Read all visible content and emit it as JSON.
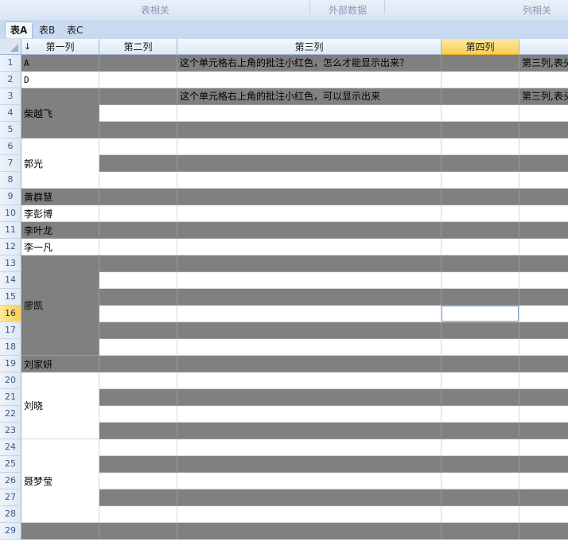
{
  "ribbon": {
    "groups": [
      {
        "label": "表相关"
      },
      {
        "label": "外部数据"
      },
      {
        "label": "列相关"
      }
    ]
  },
  "tabs": [
    {
      "label": "表A",
      "active": true
    },
    {
      "label": "表B",
      "active": false
    },
    {
      "label": "表C",
      "active": false
    }
  ],
  "grid": {
    "sort_indicator": "↓",
    "columns": [
      "第一列",
      "第二列",
      "第三列",
      "第四列",
      ""
    ],
    "selected_column": 3,
    "selected_row": 16,
    "row_numbers": [
      "1",
      "2",
      "3",
      "4",
      "5",
      "6",
      "7",
      "8",
      "9",
      "10",
      "11",
      "12",
      "13",
      "14",
      "15",
      "16",
      "17",
      "18",
      "19",
      "20",
      "21",
      "22",
      "23",
      "24",
      "25",
      "26",
      "27",
      "28",
      "29"
    ],
    "col1_cells": [
      {
        "text": "A"
      },
      {
        "text": "D"
      },
      {
        "text": "柴越飞"
      },
      {
        "text": "郭光"
      },
      {
        "text": "黄群慧"
      },
      {
        "text": "李彭博"
      },
      {
        "text": "李叶龙"
      },
      {
        "text": "李一凡"
      },
      {
        "text": "廖凯"
      },
      {
        "text": "刘家妍"
      },
      {
        "text": "刘晓"
      },
      {
        "text": "聂梦莹"
      },
      {
        "text": ""
      }
    ],
    "col3_text": {
      "row1": "这个单元格右上角的批注小红色，怎么才能显示出来？",
      "row3": "这个单元格右上角的批注小红色，可以显示出来"
    },
    "col5_text": {
      "row1": "第三列,表头",
      "row3": "第三列,表头"
    }
  }
}
